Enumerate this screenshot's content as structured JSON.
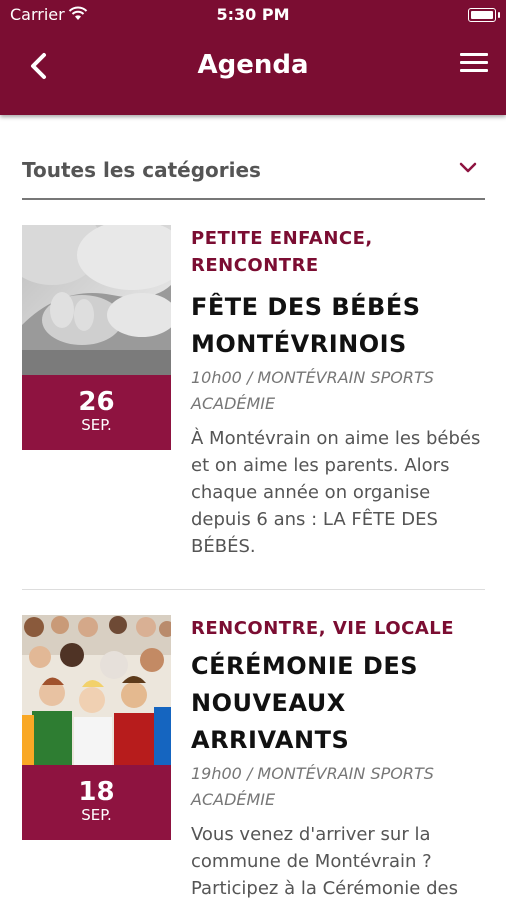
{
  "status_bar": {
    "carrier": "Carrier",
    "time": "5:30 PM"
  },
  "header": {
    "title": "Agenda",
    "back_icon": "chevron-left-icon",
    "menu_icon": "hamburger-menu-icon",
    "color": "#7b0d32"
  },
  "filter": {
    "selected": "Toutes les catégories",
    "icon": "chevron-down-icon"
  },
  "events": [
    {
      "category": "PETITE ENFANCE, RENCONTRE",
      "title": "FÊTE DES BÉBÉS MONTÉVRINOIS",
      "location": "10h00 / MONTÉVRAIN SPORTS ACADÉMIE",
      "description": "À Montévrain on aime les bébés et on aime les parents. Alors chaque année on organise depuis 6 ans : LA FÊTE DES BÉBÉS.",
      "day": "26",
      "month": "SEP."
    },
    {
      "category": "RENCONTRE, VIE LOCALE",
      "title": "CÉRÉMONIE DES NOUVEAUX ARRIVANTS",
      "location": "19h00 / MONTÉVRAIN SPORTS ACADÉMIE",
      "description": "Vous venez d'arriver sur la commune de Montévrain ? Participez à la Cérémonie des",
      "day": "18",
      "month": "SEP."
    }
  ]
}
